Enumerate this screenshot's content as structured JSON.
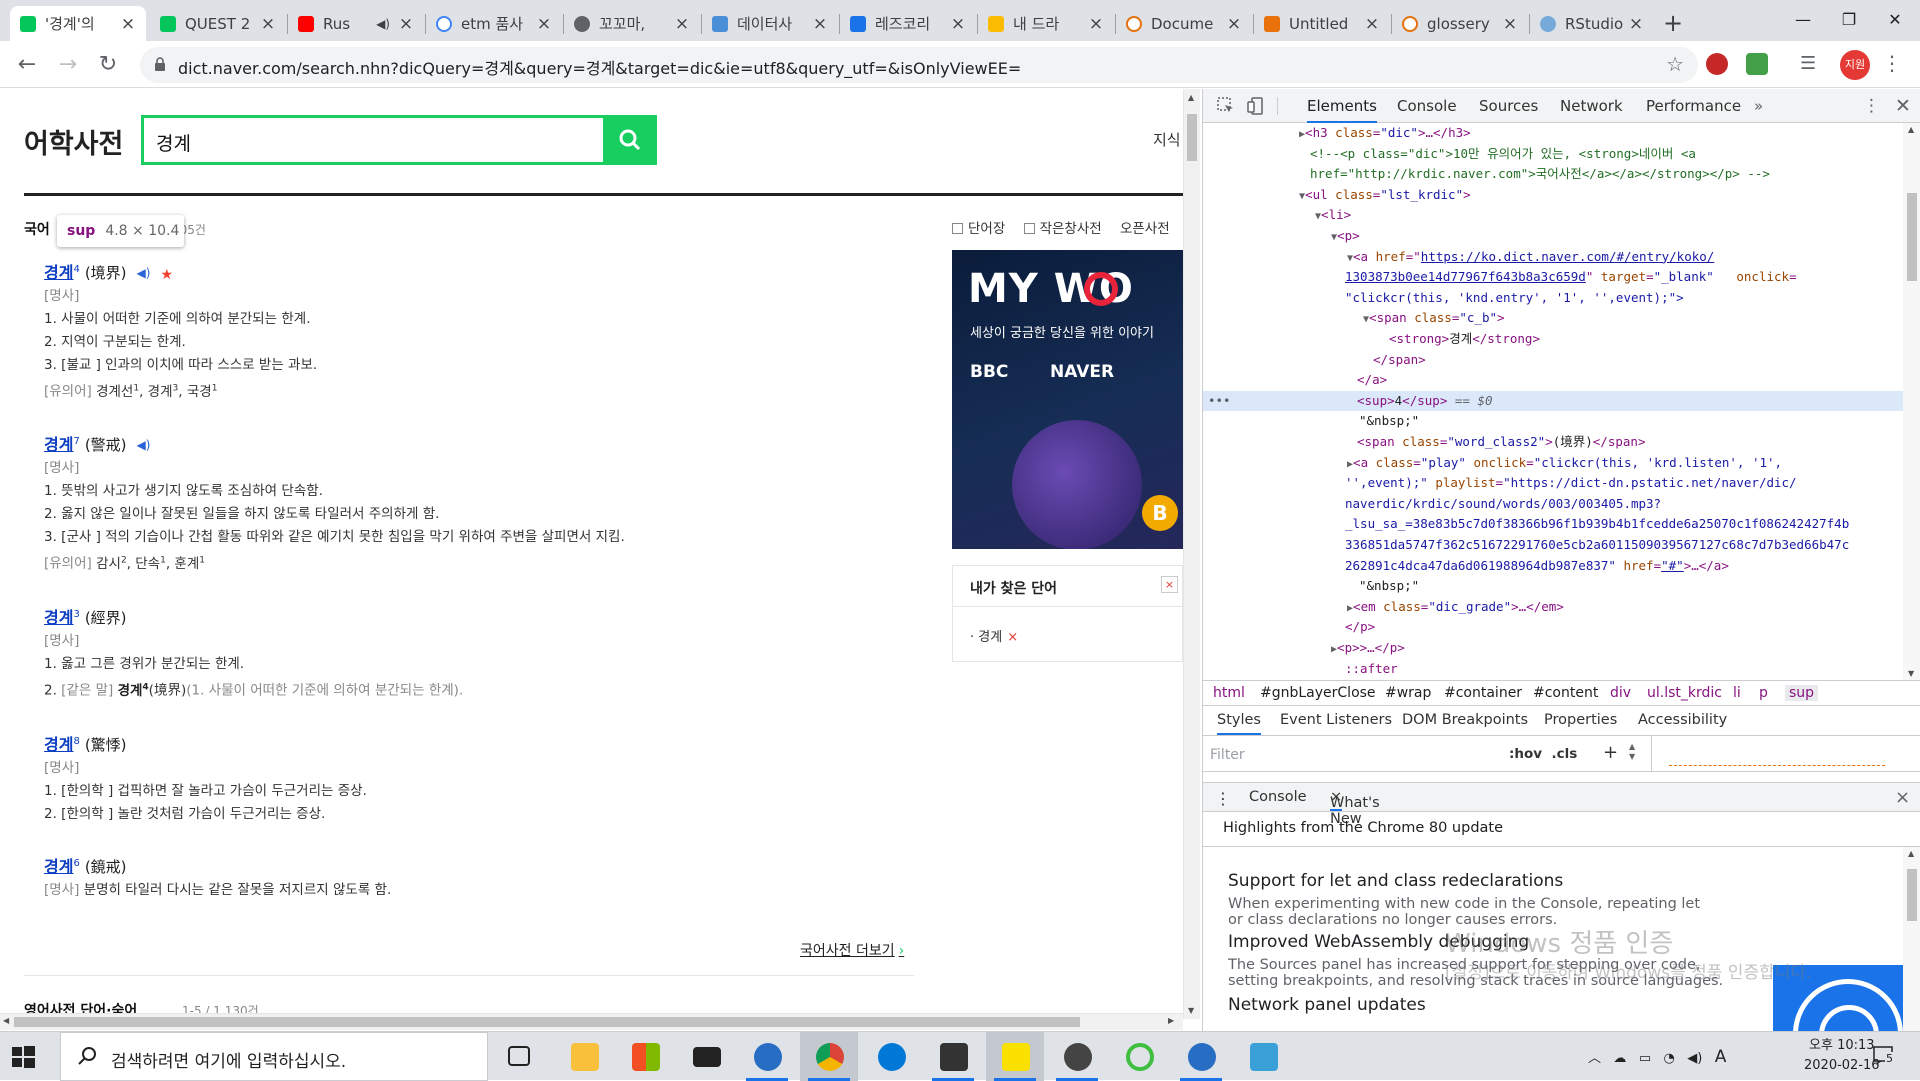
{
  "tabs": [
    {
      "title": "'경계'의",
      "color": "#03c75a",
      "active": true
    },
    {
      "title": "QUEST 2",
      "color": "#03c75a"
    },
    {
      "title": "Rus",
      "color": "#ff0000"
    },
    {
      "title": "etm 품사",
      "color": "#4285f4"
    },
    {
      "title": "꼬꼬마,",
      "color": "#5f6368"
    },
    {
      "title": "데이터사",
      "color": "#4a90d9"
    },
    {
      "title": "레즈코리",
      "color": "#1a73e8"
    },
    {
      "title": "내 드라",
      "color": "#fbbc04"
    },
    {
      "title": "Docume",
      "color": "#e8710a"
    },
    {
      "title": "Untitled",
      "color": "#e8710a"
    },
    {
      "title": "glossery",
      "color": "#e8710a"
    },
    {
      "title": "RStudio",
      "color": "#75aadb"
    }
  ],
  "address": {
    "url": "dict.naver.com/search.nhn?dicQuery=경계&query=경계&target=dic&ie=utf8&query_utf=&isOnlyViewEE="
  },
  "profile": {
    "label": "지원"
  },
  "page": {
    "brand": "어학사전",
    "query": "경계",
    "knowledge": "지식",
    "section_title": "국어",
    "section_count": "305건",
    "tooltip": {
      "tag": "sup",
      "dims": "4.8 × 10.4"
    },
    "tools": [
      "단어장",
      "작은창사전",
      "오픈사전"
    ],
    "entries": [
      {
        "word": "경계",
        "sup": "4",
        "hanja": "(境界)",
        "star": "★",
        "lines": [
          {
            "t": "[명사]",
            "g": true
          },
          {
            "t": "1. 사물이 어떠한 기준에 의하여 분간되는 한계."
          },
          {
            "t": "2. 지역이 구분되는 한계."
          },
          {
            "t": "3. [불교 ] 인과의 이치에 따라 스스로 받는 과보."
          },
          {
            "g_prefix": "[유의어]",
            "t": "경계선",
            "s1": "1",
            "m": ", 경계",
            "s2": "3",
            "e": ", 국경",
            "s3": "1"
          }
        ]
      },
      {
        "word": "경계",
        "sup": "7",
        "hanja": "(警戒)",
        "lines": [
          {
            "t": "[명사]",
            "g": true
          },
          {
            "t": "1. 뜻밖의 사고가 생기지 않도록 조심하여 단속함."
          },
          {
            "t": "2. 옳지 않은 일이나 잘못된 일들을 하지 않도록 타일러서 주의하게 함."
          },
          {
            "t": "3. [군사 ] 적의 기습이나 간첩 활동 따위와 같은 예기치 못한 침입을 막기 위하여 주변을 살피면서 지킴."
          },
          {
            "g_prefix": "[유의어]",
            "t": "감시",
            "s1": "2",
            "m": ", 단속",
            "s2": "1",
            "e": ", 훈계",
            "s3": "1"
          }
        ]
      },
      {
        "word": "경계",
        "sup": "3",
        "hanja": "(經界)",
        "lines": [
          {
            "t": "[명사]",
            "g": true
          },
          {
            "t": "1. 옳고 그른 경위가 분간되는 한계."
          },
          {
            "pre": "2. ",
            "g_prefix": "[같은 말]",
            "b": "경계",
            "bs": "4",
            "r": "(境界)",
            "gr": "(1. 사물이 어떠한 기준에 의하여 분간되는 한계)."
          }
        ]
      },
      {
        "word": "경계",
        "sup": "8",
        "hanja": "(驚悸)",
        "lines": [
          {
            "t": "[명사]",
            "g": true
          },
          {
            "t": "1. [한의학 ] 겁픽하면 잘 놀라고 가슴이 두근거리는 증상."
          },
          {
            "t": "2. [한의학 ] 놀란 것처럼 가슴이 두근거리는 증상."
          }
        ]
      },
      {
        "word": "경계",
        "sup": "6",
        "hanja": "(鏡戒)",
        "lines": [
          {
            "g_prefix": "[명사]",
            "t": " 분명히 타일러 다시는 같은 잘못을 저지르지 않도록 함."
          }
        ]
      }
    ],
    "more_link": "국어사전 더보기",
    "section2_title": "영어사전 단어·숙어",
    "section2_count": "1-5 / 1,130건",
    "ad": {
      "line1": "MY WO",
      "line1b": "RI",
      "line2": "세상이 궁금한 당신을 위한 이야기",
      "bbc": "BBC",
      "naver": "NAVER",
      "coin": "B"
    },
    "my_words": {
      "title": "내가 찾은 단어",
      "close": "×",
      "word": "경계",
      "remove": "×"
    }
  },
  "devtools": {
    "tabs": [
      "Elements",
      "Console",
      "Sources",
      "Network",
      "Performance"
    ],
    "more": "»",
    "crumbs": [
      "html",
      "#gnbLayerClose",
      "#wrap",
      "#container",
      "#content",
      "div",
      "ul.lst_krdic",
      "li",
      "p",
      "sup"
    ],
    "style_tabs": [
      "Styles",
      "Event Listeners",
      "DOM Breakpoints",
      "Properties",
      "Accessibility"
    ],
    "filter": {
      "placeholder": "Filter",
      "hov": ":hov",
      "cls": ".cls",
      "plus": "+"
    },
    "drawer": {
      "console": "Console",
      "whatsnew": "What's New",
      "close": "×"
    },
    "highlights": "Highlights from the Chrome 80 update",
    "news": [
      {
        "title": "Support for let and class redeclarations",
        "desc1": "When experimenting with new code in the Console, repeating let",
        "desc2": "or class declarations no longer causes errors."
      },
      {
        "title": "Improved WebAssembly debugging",
        "desc1": "The Sources panel has increased support for stepping over code,",
        "desc2": "setting breakpoints, and resolving stack traces in source languages."
      },
      {
        "title": "Network panel updates"
      }
    ],
    "dom": {
      "l0": {
        "t": "h3",
        "a": "class",
        "v": "\"dic\"",
        "x": ">…</",
        "t2": "h3",
        "x2": ">"
      },
      "l1": "<!--<p class=\"dic\">10만 유의어가 있는, <strong>네이버 <a",
      "l2": "href=\"http://krdic.naver.com\">국어사전</a></a></strong></p>  -->",
      "l3": {
        "t": "ul",
        "a": "class",
        "v": "\"lst_krdic\""
      },
      "l4": "li",
      "l5": "p",
      "l6": {
        "a1": "href",
        "v1": "https://ko.dict.naver.com/#/entry/koko/"
      },
      "l7": {
        "v": "1303873b0ee14d77967f643b8a3c659d",
        "a2": "target",
        "v2": "\"_blank\"",
        "a3": "onclick"
      },
      "l8": "\"clickcr(this, 'knd.entry', '1', '',event);\">",
      "l9": {
        "t": "span",
        "a": "class",
        "v": "\"c_b\""
      },
      "l10": {
        "txt": "경계"
      },
      "l11": "span",
      "l12": "a",
      "l13": {
        "t": "sup",
        "txt": "4",
        "eq": " == $0"
      },
      "l14": "\"&nbsp;\"",
      "l15": {
        "t": "span",
        "a": "class",
        "v": "\"word_class2\"",
        "txt": "(境界)"
      },
      "l16": {
        "t": "a",
        "a": "class",
        "v": "\"play\"",
        "a2": "onclick",
        "v2": "\"clickcr(this, 'krd.listen', '1',"
      },
      "l17": {
        "v": "'',event);\"",
        "a": "playlist",
        "v2": "\"https://dict-dn.pstatic.net/naver/dic/"
      },
      "l18": "naverdic/krdic/sound/words/003/003405.mp3?",
      "l19": "_lsu_sa_=38e83b5c7d0f38366b96f1b939b4b1fcedde6a25070c1f086242427f4b",
      "l20": "336851da5747f362c51672291760e5cb2a6011509039567127c68c7d7b3ed66b47c",
      "l21": {
        "v": "262891c4dca47da6d061988964db987e837\"",
        "a": "href",
        "v2": "\"#\"",
        "x": ">…</",
        "t": "a"
      },
      "l22": "\"&nbsp;\"",
      "l23": {
        "t": "em",
        "a": "class",
        "v": "\"dic_grade\"",
        "x": ">…</"
      },
      "l24": "p",
      "l25": {
        "t": "p",
        "x": ">…</"
      },
      "l26": "::after"
    }
  },
  "watermark": {
    "line1": "Windows 정품 인증",
    "line2": "[설정]으로 이동하여 Windows를 정품 인증합니다."
  },
  "taskbar": {
    "search_placeholder": "검색하려면 여기에 입력하십시오.",
    "ime": "A",
    "time": "오후 10:13",
    "date": "2020-02-16",
    "notif": "5"
  }
}
